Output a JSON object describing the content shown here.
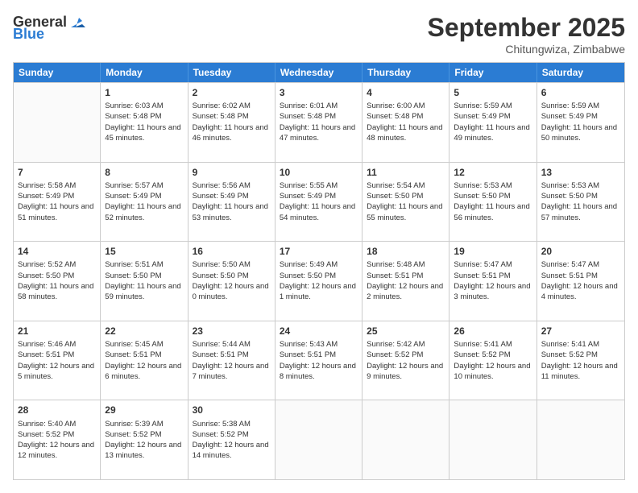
{
  "logo": {
    "general": "General",
    "blue": "Blue"
  },
  "title": "September 2025",
  "subtitle": "Chitungwiza, Zimbabwe",
  "days": [
    "Sunday",
    "Monday",
    "Tuesday",
    "Wednesday",
    "Thursday",
    "Friday",
    "Saturday"
  ],
  "weeks": [
    [
      {
        "day": "",
        "empty": true
      },
      {
        "day": "1",
        "sunrise": "6:03 AM",
        "sunset": "5:48 PM",
        "daylight": "11 hours and 45 minutes."
      },
      {
        "day": "2",
        "sunrise": "6:02 AM",
        "sunset": "5:48 PM",
        "daylight": "11 hours and 46 minutes."
      },
      {
        "day": "3",
        "sunrise": "6:01 AM",
        "sunset": "5:48 PM",
        "daylight": "11 hours and 47 minutes."
      },
      {
        "day": "4",
        "sunrise": "6:00 AM",
        "sunset": "5:48 PM",
        "daylight": "11 hours and 48 minutes."
      },
      {
        "day": "5",
        "sunrise": "5:59 AM",
        "sunset": "5:49 PM",
        "daylight": "11 hours and 49 minutes."
      },
      {
        "day": "6",
        "sunrise": "5:59 AM",
        "sunset": "5:49 PM",
        "daylight": "11 hours and 50 minutes."
      }
    ],
    [
      {
        "day": "7",
        "sunrise": "5:58 AM",
        "sunset": "5:49 PM",
        "daylight": "11 hours and 51 minutes."
      },
      {
        "day": "8",
        "sunrise": "5:57 AM",
        "sunset": "5:49 PM",
        "daylight": "11 hours and 52 minutes."
      },
      {
        "day": "9",
        "sunrise": "5:56 AM",
        "sunset": "5:49 PM",
        "daylight": "11 hours and 53 minutes."
      },
      {
        "day": "10",
        "sunrise": "5:55 AM",
        "sunset": "5:49 PM",
        "daylight": "11 hours and 54 minutes."
      },
      {
        "day": "11",
        "sunrise": "5:54 AM",
        "sunset": "5:50 PM",
        "daylight": "11 hours and 55 minutes."
      },
      {
        "day": "12",
        "sunrise": "5:53 AM",
        "sunset": "5:50 PM",
        "daylight": "11 hours and 56 minutes."
      },
      {
        "day": "13",
        "sunrise": "5:53 AM",
        "sunset": "5:50 PM",
        "daylight": "11 hours and 57 minutes."
      }
    ],
    [
      {
        "day": "14",
        "sunrise": "5:52 AM",
        "sunset": "5:50 PM",
        "daylight": "11 hours and 58 minutes."
      },
      {
        "day": "15",
        "sunrise": "5:51 AM",
        "sunset": "5:50 PM",
        "daylight": "11 hours and 59 minutes."
      },
      {
        "day": "16",
        "sunrise": "5:50 AM",
        "sunset": "5:50 PM",
        "daylight": "12 hours and 0 minutes."
      },
      {
        "day": "17",
        "sunrise": "5:49 AM",
        "sunset": "5:50 PM",
        "daylight": "12 hours and 1 minute."
      },
      {
        "day": "18",
        "sunrise": "5:48 AM",
        "sunset": "5:51 PM",
        "daylight": "12 hours and 2 minutes."
      },
      {
        "day": "19",
        "sunrise": "5:47 AM",
        "sunset": "5:51 PM",
        "daylight": "12 hours and 3 minutes."
      },
      {
        "day": "20",
        "sunrise": "5:47 AM",
        "sunset": "5:51 PM",
        "daylight": "12 hours and 4 minutes."
      }
    ],
    [
      {
        "day": "21",
        "sunrise": "5:46 AM",
        "sunset": "5:51 PM",
        "daylight": "12 hours and 5 minutes."
      },
      {
        "day": "22",
        "sunrise": "5:45 AM",
        "sunset": "5:51 PM",
        "daylight": "12 hours and 6 minutes."
      },
      {
        "day": "23",
        "sunrise": "5:44 AM",
        "sunset": "5:51 PM",
        "daylight": "12 hours and 7 minutes."
      },
      {
        "day": "24",
        "sunrise": "5:43 AM",
        "sunset": "5:51 PM",
        "daylight": "12 hours and 8 minutes."
      },
      {
        "day": "25",
        "sunrise": "5:42 AM",
        "sunset": "5:52 PM",
        "daylight": "12 hours and 9 minutes."
      },
      {
        "day": "26",
        "sunrise": "5:41 AM",
        "sunset": "5:52 PM",
        "daylight": "12 hours and 10 minutes."
      },
      {
        "day": "27",
        "sunrise": "5:41 AM",
        "sunset": "5:52 PM",
        "daylight": "12 hours and 11 minutes."
      }
    ],
    [
      {
        "day": "28",
        "sunrise": "5:40 AM",
        "sunset": "5:52 PM",
        "daylight": "12 hours and 12 minutes."
      },
      {
        "day": "29",
        "sunrise": "5:39 AM",
        "sunset": "5:52 PM",
        "daylight": "12 hours and 13 minutes."
      },
      {
        "day": "30",
        "sunrise": "5:38 AM",
        "sunset": "5:52 PM",
        "daylight": "12 hours and 14 minutes."
      },
      {
        "day": "",
        "empty": true
      },
      {
        "day": "",
        "empty": true
      },
      {
        "day": "",
        "empty": true
      },
      {
        "day": "",
        "empty": true
      }
    ]
  ],
  "labels": {
    "sunrise": "Sunrise:",
    "sunset": "Sunset:",
    "daylight": "Daylight:"
  }
}
